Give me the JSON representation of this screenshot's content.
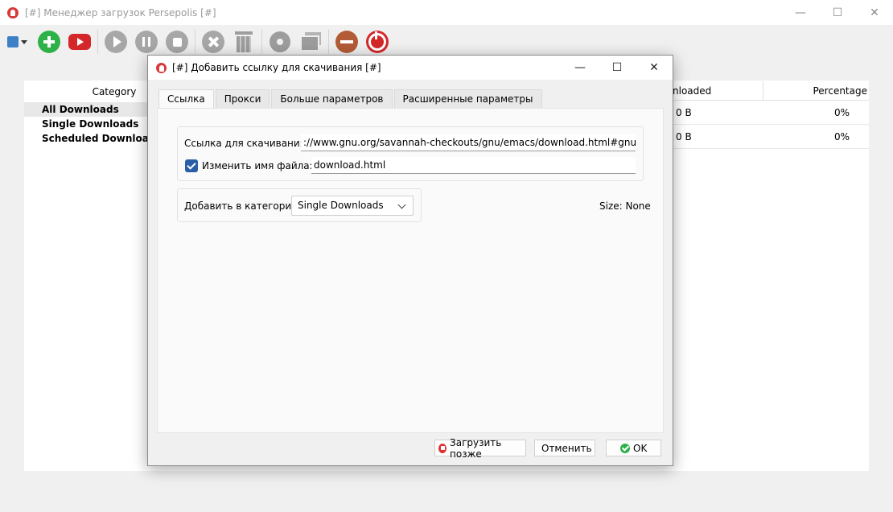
{
  "main_window": {
    "title": "[#] Менеджер загрузок Persepolis [#]",
    "controls": {
      "minimize": "—",
      "maximize": "☐",
      "close": "✕"
    }
  },
  "toolbar": {
    "icons": [
      "menu-icon",
      "add-link-icon",
      "youtube-icon",
      "resume-icon",
      "pause-icon",
      "stop-icon",
      "remove-icon",
      "delete-icon",
      "settings-icon",
      "minimize-to-tray-icon",
      "minimize-icon",
      "exit-icon"
    ]
  },
  "sidebar": {
    "header": "Category",
    "items": [
      {
        "label": "All Downloads",
        "selected": true
      },
      {
        "label": "Single Downloads",
        "selected": false
      },
      {
        "label": "Scheduled Downloads",
        "selected": false
      }
    ]
  },
  "downloads_table": {
    "columns": [
      "nloaded",
      "Percentage"
    ],
    "rows": [
      {
        "downloaded": "0 B",
        "percentage": "0%"
      },
      {
        "downloaded": "0 B",
        "percentage": "0%"
      }
    ]
  },
  "dialog": {
    "title": "[#] Добавить ссылку для скачивания [#]",
    "controls": {
      "minimize": "—",
      "maximize": "☐",
      "close": "✕"
    },
    "tabs": [
      {
        "label": "Ссылка",
        "active": true
      },
      {
        "label": "Прокси",
        "active": false
      },
      {
        "label": "Больше параметров",
        "active": false
      },
      {
        "label": "Расширенные параметры",
        "active": false
      }
    ],
    "link_label": "Ссылка для скачивания:",
    "link_value": "://www.gnu.org/savannah-checkouts/gnu/emacs/download.html#gnu-linux",
    "rename_label": "Изменить имя файла:",
    "rename_checked": true,
    "filename_value": "download.html",
    "category_label": "Добавить в категорию:",
    "category_value": "Single Downloads",
    "size_text": "Size: None",
    "buttons": {
      "later": "Загрузить позже",
      "cancel": "Отменить",
      "ok": "OK"
    }
  }
}
